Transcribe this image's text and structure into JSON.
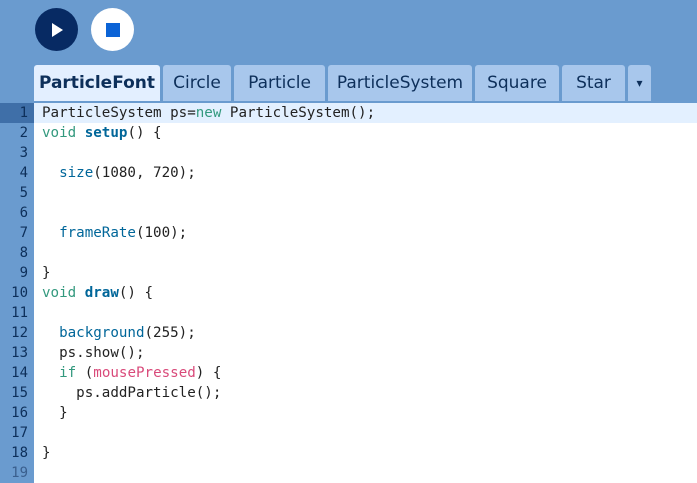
{
  "toolbar": {
    "run_icon": "play-icon",
    "stop_icon": "stop-icon"
  },
  "tabs": [
    {
      "label": "ParticleFont",
      "active": true
    },
    {
      "label": "Circle",
      "active": false
    },
    {
      "label": "Particle",
      "active": false
    },
    {
      "label": "ParticleSystem",
      "active": false
    },
    {
      "label": "Square",
      "active": false
    },
    {
      "label": "Star",
      "active": false
    }
  ],
  "tab_more_icon": "▾",
  "editor": {
    "current_line": 1,
    "lines": [
      {
        "n": "1",
        "segments": [
          [
            "",
            "ParticleSystem ps="
          ],
          [
            "kw",
            "new"
          ],
          [
            "",
            " ParticleSystem();"
          ]
        ]
      },
      {
        "n": "2",
        "segments": [
          [
            "kw",
            "void"
          ],
          [
            "",
            " "
          ],
          [
            "fnb",
            "setup"
          ],
          [
            "",
            "() {"
          ]
        ]
      },
      {
        "n": "3",
        "segments": []
      },
      {
        "n": "4",
        "segments": [
          [
            "",
            "  "
          ],
          [
            "fn",
            "size"
          ],
          [
            "",
            "(1080, 720);"
          ]
        ]
      },
      {
        "n": "5",
        "segments": []
      },
      {
        "n": "6",
        "segments": []
      },
      {
        "n": "7",
        "segments": [
          [
            "",
            "  "
          ],
          [
            "fn",
            "frameRate"
          ],
          [
            "",
            "(100);"
          ]
        ]
      },
      {
        "n": "8",
        "segments": []
      },
      {
        "n": "9",
        "segments": [
          [
            "",
            "}"
          ]
        ]
      },
      {
        "n": "10",
        "segments": [
          [
            "kw",
            "void"
          ],
          [
            "",
            " "
          ],
          [
            "fnb",
            "draw"
          ],
          [
            "",
            "() {"
          ]
        ]
      },
      {
        "n": "11",
        "segments": []
      },
      {
        "n": "12",
        "segments": [
          [
            "",
            "  "
          ],
          [
            "fn",
            "background"
          ],
          [
            "",
            "(255);"
          ]
        ]
      },
      {
        "n": "13",
        "segments": [
          [
            "",
            "  ps.show();"
          ]
        ]
      },
      {
        "n": "14",
        "segments": [
          [
            "",
            "  "
          ],
          [
            "kw",
            "if"
          ],
          [
            "",
            " ("
          ],
          [
            "var",
            "mousePressed"
          ],
          [
            "",
            ") {"
          ]
        ]
      },
      {
        "n": "15",
        "segments": [
          [
            "",
            "    ps.addParticle();"
          ]
        ]
      },
      {
        "n": "16",
        "segments": [
          [
            "",
            "  }"
          ]
        ]
      },
      {
        "n": "17",
        "segments": []
      },
      {
        "n": "18",
        "segments": [
          [
            "",
            "}"
          ]
        ]
      },
      {
        "n": "19",
        "segments": []
      }
    ]
  }
}
